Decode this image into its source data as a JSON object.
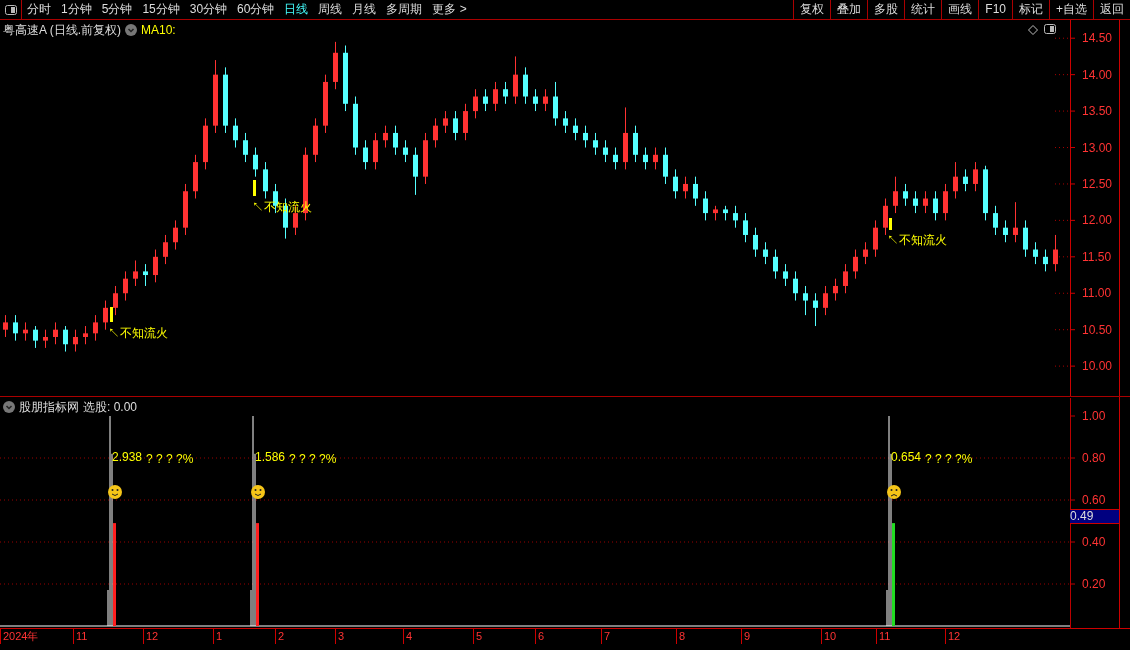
{
  "toolbar": {
    "periods": [
      {
        "label": "分时",
        "selected": false
      },
      {
        "label": "1分钟",
        "selected": false
      },
      {
        "label": "5分钟",
        "selected": false
      },
      {
        "label": "15分钟",
        "selected": false
      },
      {
        "label": "30分钟",
        "selected": false
      },
      {
        "label": "60分钟",
        "selected": false
      },
      {
        "label": "日线",
        "selected": true
      },
      {
        "label": "周线",
        "selected": false
      },
      {
        "label": "月线",
        "selected": false
      },
      {
        "label": "多周期",
        "selected": false
      },
      {
        "label": "更多 >",
        "selected": false
      }
    ],
    "buttons": [
      "复权",
      "叠加",
      "多股",
      "统计",
      "画线",
      "F10",
      "标记",
      "+自选",
      "返回"
    ]
  },
  "main_chart": {
    "title": "粤高速A (日线.前复权)",
    "indicator": "MA10:",
    "annotations": [
      "↖不知流火",
      "↖不知流火",
      "↖不知流火"
    ],
    "chart_data": {
      "type": "candlestick",
      "ylim": [
        9.59,
        14.75
      ],
      "yticks": [
        {
          "value": 14.5,
          "label": "14.50"
        },
        {
          "value": 14,
          "label": "14.00"
        },
        {
          "value": 13.5,
          "label": "13.50"
        },
        {
          "value": 13,
          "label": "13.00"
        },
        {
          "value": 12.5,
          "label": "12.50"
        },
        {
          "value": 12,
          "label": "12.00"
        },
        {
          "value": 11.5,
          "label": "11.50"
        },
        {
          "value": 11,
          "label": "11.00"
        },
        {
          "value": 10.5,
          "label": "10.50"
        },
        {
          "value": 10,
          "label": "10.00"
        }
      ],
      "categories": [
        null,
        null,
        null,
        null,
        null,
        null,
        null,
        null,
        null,
        null,
        null,
        null,
        null,
        null,
        null,
        null,
        null,
        null,
        null,
        null,
        null,
        null,
        null,
        null,
        null,
        null,
        null,
        null,
        null,
        null,
        null,
        null,
        null,
        null,
        null,
        null,
        null,
        null,
        null,
        null,
        null,
        null,
        null,
        null,
        null,
        null,
        null,
        null,
        null,
        null,
        null,
        null,
        null,
        null,
        null,
        null,
        null,
        null,
        null,
        null,
        null,
        null,
        null,
        null,
        null,
        null,
        null,
        null,
        null,
        null,
        null,
        null,
        null,
        null,
        null,
        null,
        null,
        null,
        null,
        null,
        null,
        null,
        null,
        null,
        null,
        null,
        null,
        null,
        null,
        null,
        null,
        null,
        null,
        null,
        null,
        null,
        null,
        null,
        null,
        null,
        null,
        null,
        null,
        null,
        null,
        null
      ],
      "ohlc": [
        [
          10.5,
          10.7,
          10.4,
          10.6
        ],
        [
          10.6,
          10.7,
          10.35,
          10.45
        ],
        [
          10.45,
          10.6,
          10.35,
          10.5
        ],
        [
          10.5,
          10.55,
          10.25,
          10.35
        ],
        [
          10.35,
          10.5,
          10.25,
          10.4
        ],
        [
          10.4,
          10.6,
          10.3,
          10.5
        ],
        [
          10.5,
          10.55,
          10.2,
          10.3
        ],
        [
          10.3,
          10.5,
          10.2,
          10.4
        ],
        [
          10.4,
          10.55,
          10.3,
          10.45
        ],
        [
          10.45,
          10.7,
          10.35,
          10.6
        ],
        [
          10.6,
          10.9,
          10.5,
          10.8
        ],
        [
          10.8,
          11.1,
          10.7,
          11.0
        ],
        [
          11.0,
          11.3,
          10.9,
          11.2
        ],
        [
          11.2,
          11.45,
          11.1,
          11.3
        ],
        [
          11.3,
          11.4,
          11.1,
          11.25
        ],
        [
          11.25,
          11.6,
          11.15,
          11.5
        ],
        [
          11.5,
          11.8,
          11.4,
          11.7
        ],
        [
          11.7,
          12.0,
          11.6,
          11.9
        ],
        [
          11.9,
          12.5,
          11.8,
          12.4
        ],
        [
          12.4,
          12.9,
          12.3,
          12.8
        ],
        [
          12.8,
          13.4,
          12.7,
          13.3
        ],
        [
          13.3,
          14.2,
          13.2,
          14.0
        ],
        [
          14.0,
          14.1,
          13.2,
          13.3
        ],
        [
          13.3,
          13.4,
          13.0,
          13.1
        ],
        [
          13.1,
          13.2,
          12.8,
          12.9
        ],
        [
          12.9,
          13.0,
          12.6,
          12.7
        ],
        [
          12.7,
          12.8,
          12.3,
          12.4
        ],
        [
          12.4,
          12.5,
          12.1,
          12.2
        ],
        [
          12.2,
          12.3,
          11.75,
          11.9
        ],
        [
          11.9,
          12.2,
          11.8,
          12.1
        ],
        [
          12.1,
          13.0,
          12.0,
          12.9
        ],
        [
          12.9,
          13.4,
          12.8,
          13.3
        ],
        [
          13.3,
          14.0,
          13.2,
          13.9
        ],
        [
          13.9,
          14.45,
          13.8,
          14.3
        ],
        [
          14.3,
          14.4,
          13.5,
          13.6
        ],
        [
          13.6,
          13.7,
          12.9,
          13.0
        ],
        [
          13.0,
          13.1,
          12.7,
          12.8
        ],
        [
          12.8,
          13.2,
          12.7,
          13.1
        ],
        [
          13.1,
          13.3,
          13.0,
          13.2
        ],
        [
          13.2,
          13.3,
          12.9,
          13.0
        ],
        [
          13.0,
          13.1,
          12.8,
          12.9
        ],
        [
          12.9,
          13.0,
          12.35,
          12.6
        ],
        [
          12.6,
          13.2,
          12.5,
          13.1
        ],
        [
          13.1,
          13.4,
          13.0,
          13.3
        ],
        [
          13.3,
          13.5,
          13.2,
          13.4
        ],
        [
          13.4,
          13.5,
          13.1,
          13.2
        ],
        [
          13.2,
          13.6,
          13.1,
          13.5
        ],
        [
          13.5,
          13.8,
          13.4,
          13.7
        ],
        [
          13.7,
          13.8,
          13.5,
          13.6
        ],
        [
          13.6,
          13.9,
          13.5,
          13.8
        ],
        [
          13.8,
          13.9,
          13.6,
          13.7
        ],
        [
          13.7,
          14.25,
          13.6,
          14.0
        ],
        [
          14.0,
          14.1,
          13.6,
          13.7
        ],
        [
          13.7,
          13.8,
          13.5,
          13.6
        ],
        [
          13.6,
          13.8,
          13.5,
          13.7
        ],
        [
          13.7,
          13.9,
          13.3,
          13.4
        ],
        [
          13.4,
          13.5,
          13.2,
          13.3
        ],
        [
          13.3,
          13.4,
          13.1,
          13.2
        ],
        [
          13.2,
          13.3,
          13.0,
          13.1
        ],
        [
          13.1,
          13.2,
          12.9,
          13.0
        ],
        [
          13.0,
          13.1,
          12.8,
          12.9
        ],
        [
          12.9,
          13.0,
          12.7,
          12.8
        ],
        [
          12.8,
          13.55,
          12.7,
          13.2
        ],
        [
          13.2,
          13.3,
          12.8,
          12.9
        ],
        [
          12.9,
          13.0,
          12.7,
          12.8
        ],
        [
          12.8,
          13.0,
          12.7,
          12.9
        ],
        [
          12.9,
          13.0,
          12.5,
          12.6
        ],
        [
          12.6,
          12.7,
          12.3,
          12.4
        ],
        [
          12.4,
          12.6,
          12.3,
          12.5
        ],
        [
          12.5,
          12.6,
          12.2,
          12.3
        ],
        [
          12.3,
          12.4,
          12.0,
          12.1
        ],
        [
          12.1,
          12.2,
          12.0,
          12.15
        ],
        [
          12.15,
          12.2,
          12.0,
          12.1
        ],
        [
          12.1,
          12.2,
          11.9,
          12.0
        ],
        [
          12.0,
          12.1,
          11.7,
          11.8
        ],
        [
          11.8,
          11.9,
          11.5,
          11.6
        ],
        [
          11.6,
          11.7,
          11.4,
          11.5
        ],
        [
          11.5,
          11.6,
          11.2,
          11.3
        ],
        [
          11.3,
          11.4,
          11.1,
          11.2
        ],
        [
          11.2,
          11.3,
          10.9,
          11.0
        ],
        [
          11.0,
          11.1,
          10.7,
          10.9
        ],
        [
          10.9,
          11.0,
          10.55,
          10.8
        ],
        [
          10.8,
          11.1,
          10.7,
          11.0
        ],
        [
          11.0,
          11.2,
          10.9,
          11.1
        ],
        [
          11.1,
          11.4,
          11.0,
          11.3
        ],
        [
          11.3,
          11.6,
          11.2,
          11.5
        ],
        [
          11.5,
          11.7,
          11.4,
          11.6
        ],
        [
          11.6,
          12.0,
          11.5,
          11.9
        ],
        [
          11.9,
          12.3,
          11.8,
          12.2
        ],
        [
          12.2,
          12.6,
          12.1,
          12.4
        ],
        [
          12.4,
          12.5,
          12.2,
          12.3
        ],
        [
          12.3,
          12.4,
          12.1,
          12.2
        ],
        [
          12.2,
          12.4,
          12.1,
          12.3
        ],
        [
          12.3,
          12.4,
          12.0,
          12.1
        ],
        [
          12.1,
          12.5,
          12.0,
          12.4
        ],
        [
          12.4,
          12.8,
          12.3,
          12.6
        ],
        [
          12.6,
          12.7,
          12.4,
          12.5
        ],
        [
          12.5,
          12.8,
          12.4,
          12.7
        ],
        [
          12.7,
          12.75,
          12.0,
          12.1
        ],
        [
          12.1,
          12.2,
          11.8,
          11.9
        ],
        [
          11.9,
          12.0,
          11.7,
          11.8
        ],
        [
          11.8,
          12.25,
          11.7,
          11.9
        ],
        [
          11.9,
          12.0,
          11.5,
          11.6
        ],
        [
          11.6,
          11.7,
          11.4,
          11.5
        ],
        [
          11.5,
          11.6,
          11.3,
          11.4
        ],
        [
          11.4,
          11.8,
          11.3,
          11.6
        ]
      ]
    }
  },
  "indicator_panel": {
    "title": "股朋指标网",
    "reading": "选股: 0.00",
    "axis": [
      "1.00",
      "0.80",
      "0.60",
      "0.40",
      "0.20"
    ],
    "current": "0.49",
    "signals": [
      {
        "value": "2.938",
        "note": "? ? ? ?%",
        "kind": "happy",
        "color": "#ff2020"
      },
      {
        "value": "1.586",
        "note": "? ? ? ?%",
        "kind": "happy",
        "color": "#ff2020"
      },
      {
        "value": "0.654",
        "note": "? ? ? ?%",
        "kind": "sad",
        "color": "#22dd22"
      }
    ]
  },
  "date_axis": [
    "2024年",
    "11",
    "12",
    "1",
    "2",
    "3",
    "4",
    "5",
    "6",
    "7",
    "8",
    "9",
    "10",
    "11",
    "12"
  ]
}
